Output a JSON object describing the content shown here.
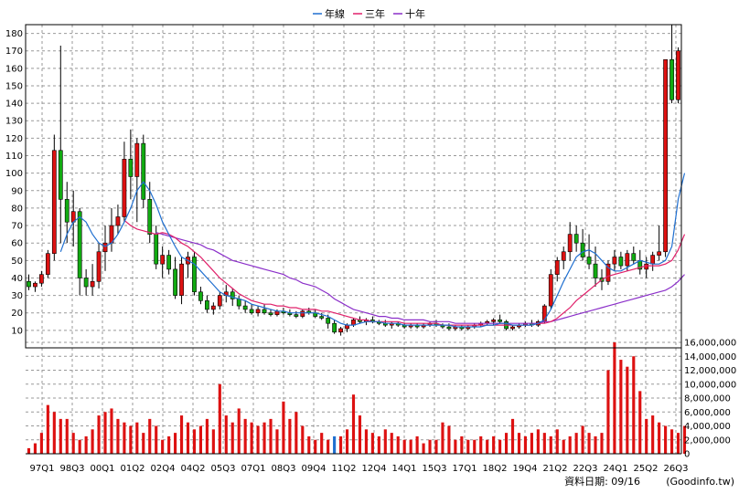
{
  "chart_data": [
    {
      "type": "candlestick",
      "panel": "price",
      "ylim": [
        0,
        185
      ],
      "yticks": [
        10,
        20,
        30,
        40,
        50,
        60,
        70,
        80,
        90,
        100,
        110,
        120,
        130,
        140,
        150,
        160,
        170,
        180
      ],
      "grid": true,
      "legend_placement": "top-center",
      "legend": [
        "年線",
        "三年",
        "十年"
      ],
      "x_labels": [
        "97Q1",
        "98Q3",
        "00Q1",
        "01Q2",
        "02Q4",
        "04Q2",
        "05Q3",
        "07Q1",
        "08Q3",
        "09Q4",
        "11Q2",
        "12Q4",
        "14Q1",
        "15Q3",
        "17Q1",
        "18Q2",
        "19Q4",
        "21Q2",
        "22Q3",
        "24Q1",
        "25Q2",
        "26Q3"
      ],
      "series_colors": {
        "年線": "#1f6fd0",
        "三年": "#e0206a",
        "十年": "#8b2fc9"
      },
      "candle_colors": {
        "up": "#dd1111",
        "down": "#11aa11",
        "outline": "#000000"
      },
      "candles": [
        [
          38,
          42,
          33,
          35
        ],
        [
          35,
          38,
          32,
          37
        ],
        [
          37,
          44,
          35,
          42
        ],
        [
          42,
          56,
          40,
          54
        ],
        [
          54,
          122,
          50,
          113
        ],
        [
          113,
          173,
          60,
          85
        ],
        [
          85,
          95,
          60,
          72
        ],
        [
          72,
          90,
          58,
          78
        ],
        [
          78,
          80,
          30,
          40
        ],
        [
          40,
          45,
          30,
          35
        ],
        [
          35,
          48,
          30,
          38
        ],
        [
          38,
          60,
          34,
          55
        ],
        [
          55,
          70,
          44,
          60
        ],
        [
          60,
          80,
          55,
          70
        ],
        [
          70,
          82,
          65,
          75
        ],
        [
          75,
          118,
          72,
          108
        ],
        [
          108,
          125,
          85,
          98
        ],
        [
          98,
          120,
          72,
          117
        ],
        [
          117,
          122,
          80,
          85
        ],
        [
          85,
          95,
          60,
          65
        ],
        [
          65,
          70,
          45,
          48
        ],
        [
          48,
          58,
          40,
          53
        ],
        [
          53,
          56,
          42,
          45
        ],
        [
          45,
          52,
          28,
          30
        ],
        [
          30,
          52,
          25,
          48
        ],
        [
          48,
          55,
          40,
          52
        ],
        [
          52,
          55,
          30,
          32
        ],
        [
          32,
          35,
          25,
          27
        ],
        [
          27,
          30,
          20,
          22
        ],
        [
          22,
          26,
          19,
          24
        ],
        [
          24,
          32,
          22,
          30
        ],
        [
          30,
          36,
          26,
          32
        ],
        [
          32,
          34,
          24,
          28
        ],
        [
          28,
          30,
          22,
          24
        ],
        [
          24,
          27,
          20,
          22
        ],
        [
          22,
          25,
          19,
          20
        ],
        [
          20,
          24,
          18,
          22
        ],
        [
          22,
          25,
          19,
          20
        ],
        [
          20,
          22,
          18,
          19
        ],
        [
          19,
          22,
          18,
          21
        ],
        [
          21,
          23,
          19,
          20
        ],
        [
          20,
          22,
          18,
          19
        ],
        [
          19,
          21,
          17,
          18
        ],
        [
          18,
          22,
          17,
          21
        ],
        [
          21,
          23,
          19,
          20
        ],
        [
          20,
          22,
          17,
          18
        ],
        [
          18,
          20,
          16,
          17
        ],
        [
          17,
          19,
          11,
          14
        ],
        [
          14,
          16,
          8,
          9
        ],
        [
          9,
          12,
          7,
          11
        ],
        [
          11,
          14,
          9,
          13
        ],
        [
          13,
          17,
          12,
          16
        ],
        [
          16,
          18,
          14,
          15
        ],
        [
          15,
          17,
          13,
          16
        ],
        [
          16,
          18,
          14,
          15
        ],
        [
          15,
          16,
          13,
          14
        ],
        [
          14,
          16,
          12,
          13
        ],
        [
          13,
          15,
          11,
          14
        ],
        [
          14,
          15,
          12,
          13
        ],
        [
          13,
          14,
          11,
          12
        ],
        [
          12,
          14,
          11,
          13
        ],
        [
          13,
          14,
          11,
          12
        ],
        [
          12,
          14,
          11,
          13
        ],
        [
          13,
          15,
          12,
          14
        ],
        [
          14,
          16,
          12,
          13
        ],
        [
          13,
          14,
          11,
          12
        ],
        [
          12,
          14,
          10,
          11
        ],
        [
          11,
          13,
          10,
          12
        ],
        [
          12,
          13,
          10,
          11
        ],
        [
          11,
          13,
          10,
          12
        ],
        [
          12,
          14,
          11,
          13
        ],
        [
          13,
          15,
          12,
          14
        ],
        [
          14,
          16,
          13,
          15
        ],
        [
          15,
          17,
          13,
          16
        ],
        [
          16,
          19,
          14,
          15
        ],
        [
          15,
          16,
          10,
          11
        ],
        [
          11,
          13,
          10,
          12
        ],
        [
          12,
          14,
          11,
          13
        ],
        [
          13,
          15,
          12,
          14
        ],
        [
          14,
          16,
          12,
          13
        ],
        [
          13,
          16,
          12,
          15
        ],
        [
          15,
          25,
          14,
          24
        ],
        [
          24,
          45,
          22,
          42
        ],
        [
          42,
          52,
          38,
          50
        ],
        [
          50,
          58,
          45,
          55
        ],
        [
          55,
          72,
          50,
          65
        ],
        [
          65,
          70,
          55,
          60
        ],
        [
          60,
          68,
          50,
          52
        ],
        [
          52,
          65,
          45,
          48
        ],
        [
          48,
          58,
          35,
          40
        ],
        [
          40,
          45,
          33,
          38
        ],
        [
          38,
          50,
          36,
          48
        ],
        [
          48,
          56,
          44,
          52
        ],
        [
          52,
          55,
          45,
          47
        ],
        [
          47,
          56,
          44,
          54
        ],
        [
          54,
          58,
          48,
          50
        ],
        [
          50,
          56,
          42,
          45
        ],
        [
          45,
          52,
          40,
          48
        ],
        [
          48,
          55,
          44,
          53
        ],
        [
          53,
          70,
          50,
          55
        ],
        [
          55,
          80,
          52,
          165
        ],
        [
          165,
          185,
          140,
          142
        ],
        [
          142,
          172,
          140,
          170
        ]
      ],
      "ma_yearly": [
        null,
        null,
        null,
        null,
        null,
        55,
        65,
        72,
        75,
        72,
        65,
        60,
        58,
        60,
        65,
        72,
        80,
        90,
        95,
        90,
        82,
        72,
        65,
        58,
        52,
        50,
        48,
        44,
        40,
        36,
        32,
        30,
        29,
        28,
        27,
        25,
        24,
        23,
        22,
        21,
        21,
        20,
        20,
        20,
        20,
        20,
        19,
        18,
        16,
        14,
        13,
        13,
        14,
        15,
        15,
        15,
        14,
        14,
        14,
        13,
        13,
        13,
        13,
        13,
        13,
        13,
        13,
        12,
        12,
        12,
        12,
        12,
        13,
        13,
        14,
        14,
        13,
        13,
        13,
        13,
        14,
        16,
        22,
        30,
        38,
        45,
        52,
        55,
        56,
        54,
        50,
        46,
        44,
        44,
        46,
        48,
        50,
        49,
        48,
        48,
        50,
        58,
        85,
        100
      ],
      "ma_3y": [
        null,
        null,
        null,
        null,
        null,
        null,
        null,
        null,
        null,
        null,
        null,
        null,
        null,
        null,
        null,
        73,
        70,
        68,
        67,
        66,
        65,
        66,
        65,
        63,
        60,
        58,
        55,
        52,
        48,
        44,
        40,
        37,
        34,
        31,
        29,
        27,
        26,
        25,
        25,
        24,
        24,
        23,
        23,
        22,
        22,
        22,
        21,
        21,
        20,
        19,
        18,
        17,
        16,
        16,
        15,
        15,
        15,
        15,
        15,
        14,
        14,
        14,
        14,
        14,
        14,
        13,
        13,
        13,
        13,
        13,
        13,
        13,
        13,
        13,
        13,
        13,
        13,
        13,
        13,
        13,
        14,
        14,
        15,
        17,
        20,
        23,
        27,
        30,
        33,
        36,
        39,
        41,
        42,
        43,
        44,
        45,
        46,
        47,
        47,
        47,
        48,
        50,
        56,
        65
      ],
      "ma_10y": [
        null,
        null,
        null,
        null,
        null,
        null,
        null,
        null,
        null,
        null,
        null,
        null,
        null,
        null,
        null,
        null,
        null,
        null,
        null,
        null,
        66,
        65,
        64,
        63,
        62,
        61,
        60,
        59,
        57,
        56,
        54,
        52,
        50,
        49,
        48,
        47,
        46,
        45,
        44,
        43,
        42,
        40,
        39,
        37,
        36,
        35,
        33,
        31,
        28,
        26,
        24,
        22,
        21,
        20,
        19,
        18,
        18,
        17,
        17,
        16,
        16,
        16,
        16,
        15,
        15,
        15,
        15,
        14,
        14,
        14,
        14,
        14,
        14,
        14,
        14,
        14,
        14,
        14,
        14,
        14,
        14,
        15,
        15,
        16,
        17,
        18,
        19,
        20,
        21,
        22,
        23,
        24,
        25,
        26,
        27,
        28,
        29,
        30,
        31,
        32,
        33,
        35,
        38,
        42
      ]
    },
    {
      "type": "bar",
      "panel": "volume",
      "ylim": [
        0,
        16000000
      ],
      "y_tick_labels": [
        "16,000,000",
        "14,000,000",
        "12,000,000",
        "10,000,000",
        "8,000,000",
        "6,000,000",
        "4,000,000",
        "2,000,000",
        "0"
      ],
      "color": "#dd1111",
      "highlight_color": "#1f6fd0",
      "values": [
        800000,
        1500000,
        3000000,
        7000000,
        6000000,
        5000000,
        5000000,
        3000000,
        2000000,
        2500000,
        3500000,
        5500000,
        6000000,
        6500000,
        5000000,
        4500000,
        4000000,
        4500000,
        3000000,
        5000000,
        4000000,
        2000000,
        2500000,
        3000000,
        5500000,
        4500000,
        3500000,
        4000000,
        5000000,
        3500000,
        10000000,
        5500000,
        4500000,
        6500000,
        5000000,
        4500000,
        4000000,
        4500000,
        5000000,
        3500000,
        7500000,
        5000000,
        6000000,
        4000000,
        2500000,
        2000000,
        3000000,
        2000000,
        2500000,
        2500000,
        3500000,
        8500000,
        5500000,
        3500000,
        3000000,
        2500000,
        3500000,
        3000000,
        2500000,
        2000000,
        2000000,
        2500000,
        1500000,
        2000000,
        2000000,
        4500000,
        4000000,
        2000000,
        2500000,
        2000000,
        2000000,
        2500000,
        2000000,
        2500000,
        2000000,
        3000000,
        5000000,
        3000000,
        2500000,
        3000000,
        3500000,
        3000000,
        2500000,
        3500000,
        2000000,
        2500000,
        3000000,
        4000000,
        3000000,
        2500000,
        3000000,
        12000000,
        16000000,
        13500000,
        12500000,
        14000000,
        9000000,
        5000000,
        5500000,
        4500000,
        4000000,
        3500000,
        3000000,
        4000000
      ],
      "highlight_index": 48
    }
  ],
  "footer": {
    "date_label": "資料日期: 09/16",
    "source": "(Goodinfo.tw)"
  }
}
